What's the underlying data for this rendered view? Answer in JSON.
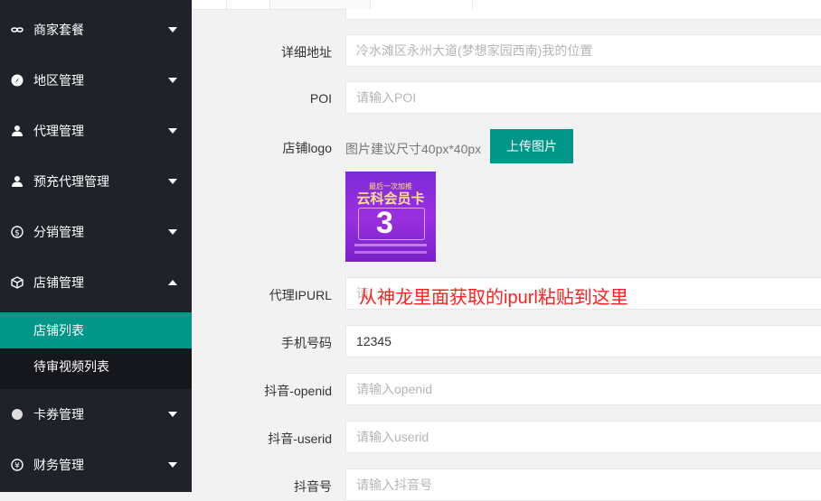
{
  "sidebar": {
    "items": [
      {
        "label": "商家套餐",
        "icon": "link-icon",
        "expanded": false
      },
      {
        "label": "地区管理",
        "icon": "compass-icon",
        "expanded": false
      },
      {
        "label": "代理管理",
        "icon": "user-icon",
        "expanded": false
      },
      {
        "label": "预充代理管理",
        "icon": "user-icon",
        "expanded": false
      },
      {
        "label": "分销管理",
        "icon": "dollar-icon",
        "expanded": false
      },
      {
        "label": "店铺管理",
        "icon": "cube-icon",
        "expanded": true
      },
      {
        "label": "卡券管理",
        "icon": "circle-icon",
        "expanded": false
      },
      {
        "label": "财务管理",
        "icon": "yen-icon",
        "expanded": false
      }
    ],
    "submenu": [
      {
        "label": "店铺列表",
        "active": true
      },
      {
        "label": "待审视频列表",
        "active": false
      }
    ]
  },
  "form": {
    "address": {
      "label": "详细地址",
      "placeholder": "冷水滩区永州大道(梦想家园西南)我的位置"
    },
    "poi": {
      "label": "POI",
      "placeholder": "请输入POI"
    },
    "logo": {
      "label": "店铺logo",
      "hint": "图片建议尺寸40px*40px",
      "upload_label": "上传图片"
    },
    "ipurl": {
      "label": "代理IPURL",
      "placeholder": "请"
    },
    "phone": {
      "label": "手机号码",
      "value": "12345"
    },
    "openid": {
      "label": "抖音-openid",
      "placeholder": "请输入openid"
    },
    "userid": {
      "label": "抖音-userid",
      "placeholder": "请输入userid"
    },
    "douyin": {
      "label": "抖音号",
      "placeholder": "请输入抖音号"
    }
  },
  "logo_image": {
    "line1": "最后一次加推",
    "line2": "云科会员卡",
    "big": "3"
  },
  "annotation": "从神龙里面获取的ipurl粘贴到这里",
  "colors": {
    "accent": "#009688",
    "sidebar_bg": "#20222a",
    "annotation": "#ff2020"
  }
}
